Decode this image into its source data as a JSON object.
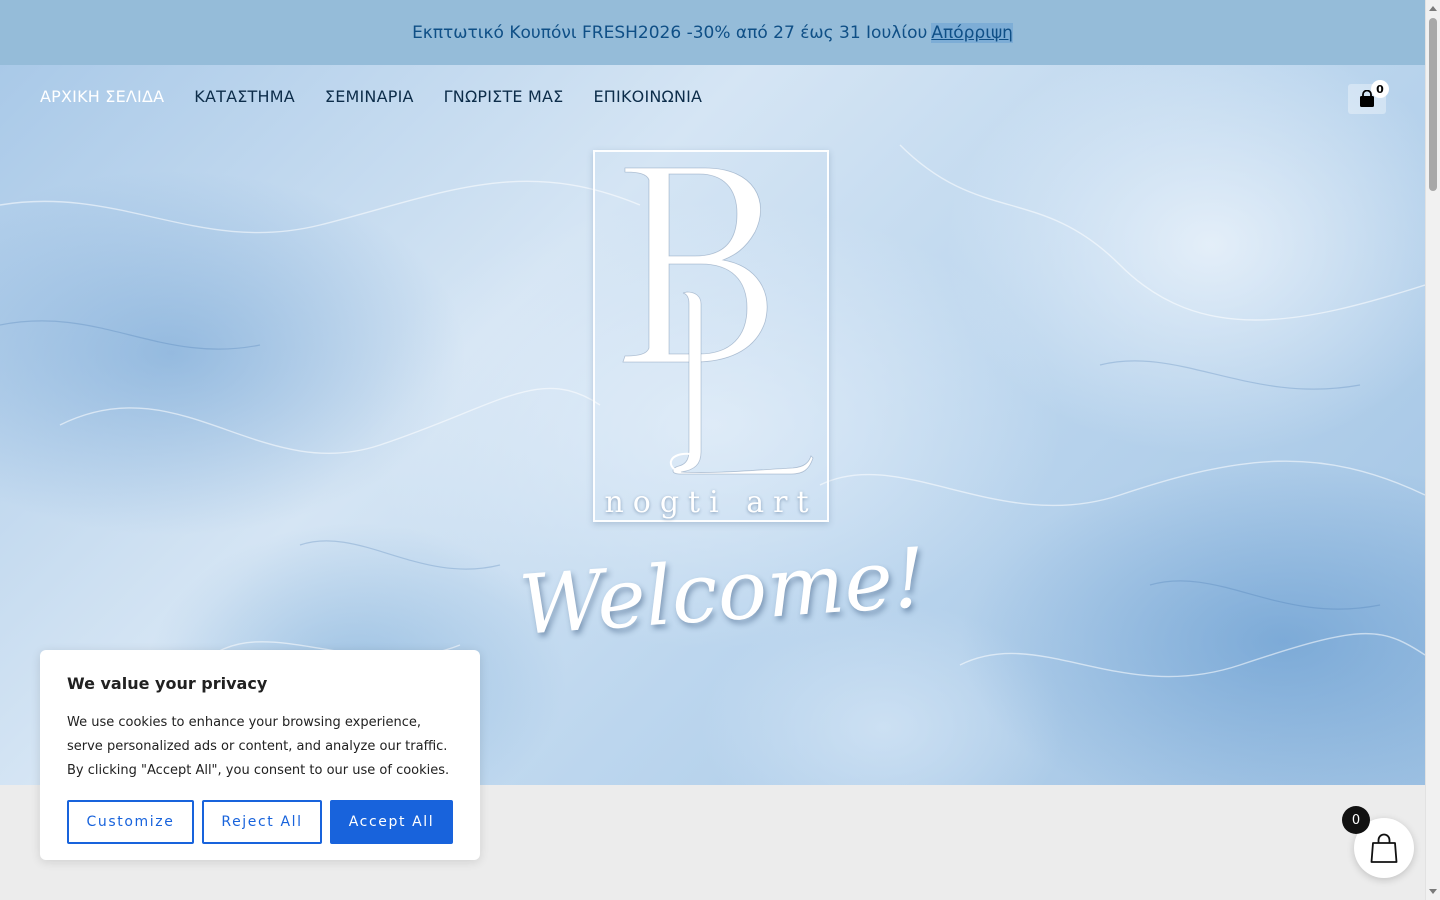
{
  "promo": {
    "text": "Εκπτωτικό Κουπόνι FRESH2026 -30% από 27 έως 31 Ιουλίου",
    "dismiss_label": "Απόρριψη"
  },
  "nav": {
    "items": [
      {
        "label": "ΑΡΧΙΚΗ ΣΕΛΙΔΑ"
      },
      {
        "label": "ΚΑΤΑΣΤΗΜΑ"
      },
      {
        "label": "ΣΕΜΙΝΑΡΙΑ"
      },
      {
        "label": "ΓΝΩΡΙΣΤΕ ΜΑΣ"
      },
      {
        "label": "ΕΠΙΚΟΙΝΩΝΙΑ"
      }
    ],
    "cart_count": "0",
    "cart_icon": "shopping-bag-icon"
  },
  "hero": {
    "logo_letters": "BL",
    "logo_tagline": "nogti art",
    "welcome": "Welcome!"
  },
  "cookie": {
    "title": "We value your privacy",
    "text": "We use cookies to enhance your browsing experience, serve personalized ads or content, and analyze our traffic. By clicking \"Accept All\", you consent to our use of cookies.",
    "customize_label": "Customize",
    "reject_label": "Reject All",
    "accept_label": "Accept All"
  },
  "floating_cart": {
    "count": "0",
    "icon": "shopping-bag-icon"
  },
  "colors": {
    "promo_bg": "#95bcd9",
    "promo_text": "#0f4f86",
    "accent": "#1863dc",
    "nav_text": "#0d2d4a"
  }
}
